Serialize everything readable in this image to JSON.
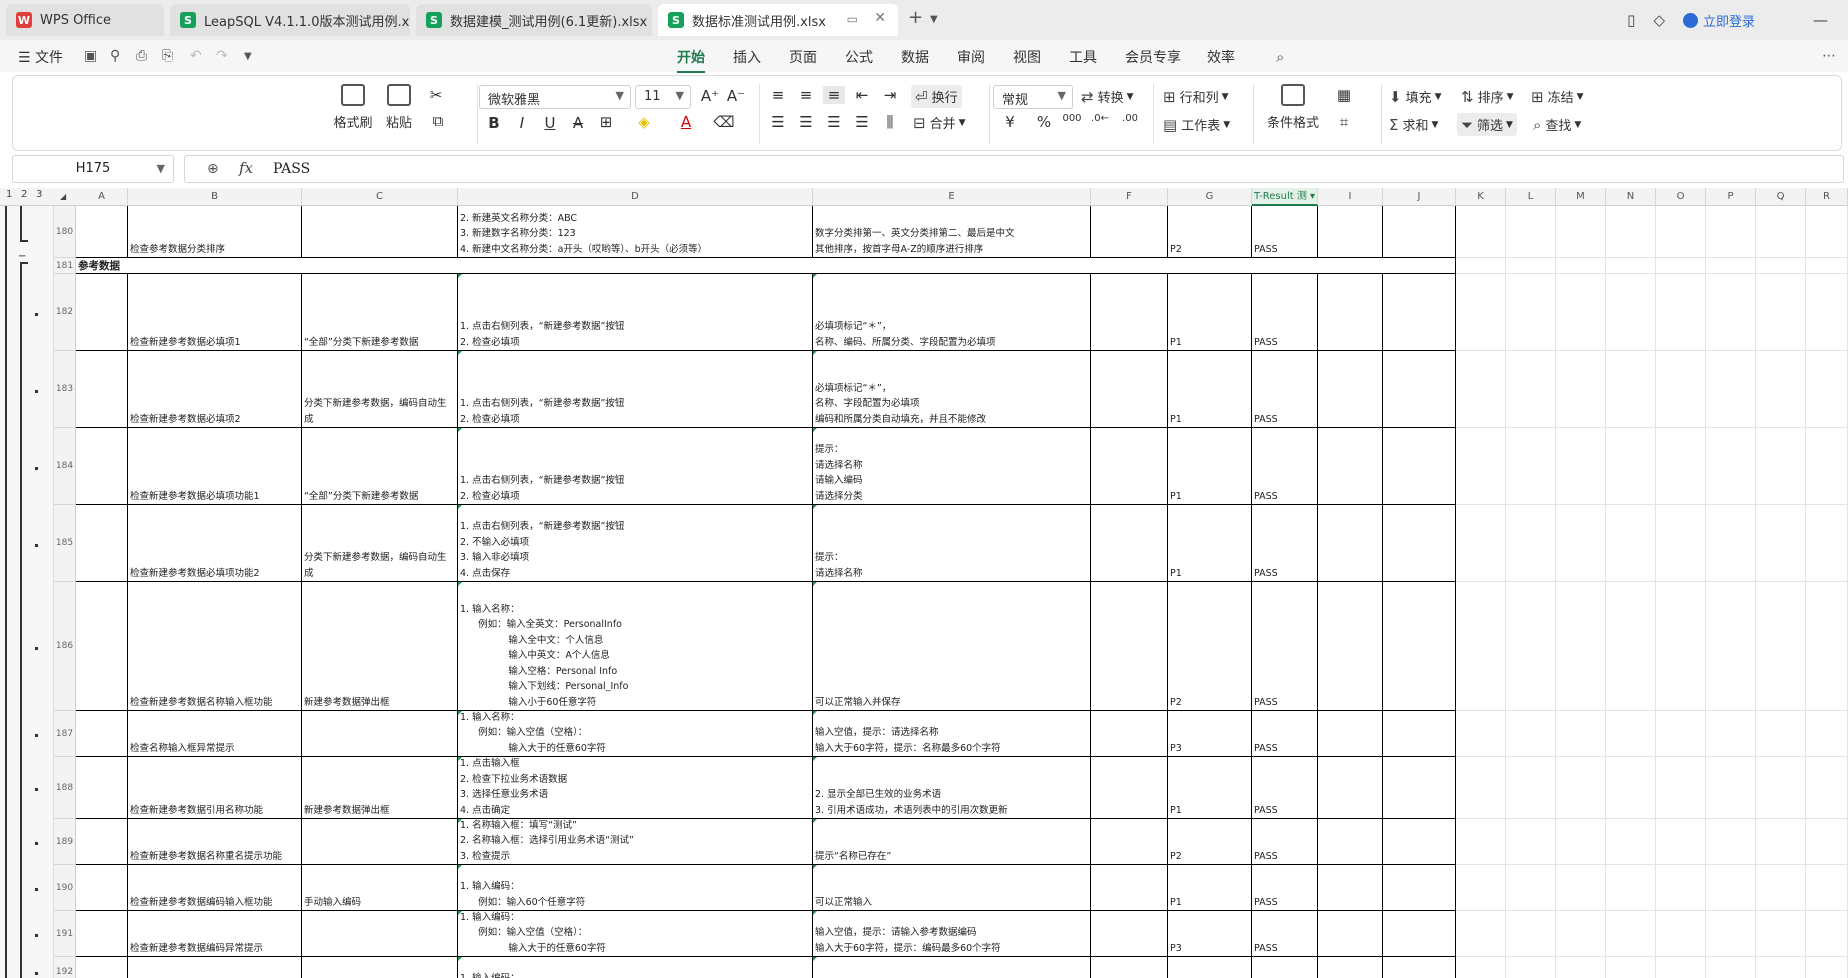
{
  "tabs": [
    {
      "label": "WPS Office",
      "icon": "W",
      "active": false
    },
    {
      "label": "LeapSQL V4.1.1.0版本测试用例.xlsx",
      "icon": "S",
      "active": false
    },
    {
      "label": "数据建模_测试用例(6.1更新).xlsx",
      "icon": "S",
      "active": false
    },
    {
      "label": "数据标准测试用例.xlsx",
      "icon": "S",
      "active": true
    }
  ],
  "titlebar": {
    "login": "立即登录"
  },
  "menu": {
    "file": "文件",
    "items": [
      "开始",
      "插入",
      "页面",
      "公式",
      "数据",
      "审阅",
      "视图",
      "工具",
      "会员专享",
      "效率"
    ],
    "active": "开始"
  },
  "ribbon": {
    "format_painter": "格式刷",
    "paste": "粘贴",
    "font_name": "微软雅黑",
    "font_size": "11",
    "wrap": "换行",
    "merge": "合并",
    "number_format": "常规",
    "convert": "转换",
    "row_col": "行和列",
    "worksheet": "工作表",
    "cond_format": "条件格式",
    "fill": "填充",
    "sort": "排序",
    "freeze": "冻结",
    "sum": "求和",
    "filter": "筛选",
    "find": "查找"
  },
  "formula_bar": {
    "name_box": "H175",
    "fx": "fx",
    "value": "PASS"
  },
  "grid": {
    "outline_levels": [
      "1",
      "2",
      "3"
    ],
    "columns": [
      "A",
      "B",
      "C",
      "D",
      "E",
      "F",
      "G",
      "T-Result 测",
      "I",
      "J",
      "K",
      "L",
      "M",
      "N",
      "O",
      "P",
      "Q",
      "R"
    ],
    "section_title": "参考数据",
    "rows": [
      {
        "num": "180",
        "b": "检查参考数据分类排序",
        "c": "",
        "d": "2. 新建英文名称分类：ABC\n3. 新建数字名称分类：123\n4. 新建中文名称分类：a开头（哎哟等）、b开头（必须等）",
        "e": "数字分类排第一、英文分类排第二、最后是中文\n其他排序，按首字母A-Z的顺序进行排序",
        "g": "P2",
        "h": "PASS"
      },
      {
        "num": "181",
        "section": true
      },
      {
        "num": "182",
        "b": "检查新建参考数据必填项1",
        "c": "“全部”分类下新建参考数据",
        "d": "1. 点击右侧列表，“新建参考数据”按钮\n2. 检查必填项",
        "e": "必填项标记“＊”，\n名称、编码、所属分类、字段配置为必填项",
        "g": "P1",
        "h": "PASS"
      },
      {
        "num": "183",
        "b": "检查新建参考数据必填项2",
        "c": "分类下新建参考数据，编码自动生\n成",
        "d": "1. 点击右侧列表，“新建参考数据”按钮\n2. 检查必填项",
        "e": "必填项标记“＊”，\n名称、字段配置为必填项\n编码和所属分类自动填充，并且不能修改",
        "g": "P1",
        "h": "PASS"
      },
      {
        "num": "184",
        "b": "检查新建参考数据必填项功能1",
        "c": "“全部”分类下新建参考数据",
        "d": "1. 点击右侧列表，“新建参考数据”按钮\n2. 检查必填项",
        "e": "提示：\n请选择名称\n请输入编码\n请选择分类",
        "g": "P1",
        "h": "PASS"
      },
      {
        "num": "185",
        "b": "检查新建参考数据必填项功能2",
        "c": "分类下新建参考数据，编码自动生\n成",
        "d": "1. 点击右侧列表，“新建参考数据”按钮\n2. 不输入必填项\n3. 输入非必填项\n4. 点击保存",
        "e": "提示：\n请选择名称",
        "g": "P1",
        "h": "PASS"
      },
      {
        "num": "186",
        "b": "检查新建参考数据名称输入框功能",
        "c": "新建参考数据弹出框",
        "d": "1. 输入名称：\n      例如：输入全英文：PersonalInfo\n                输入全中文：个人信息\n                输入中英文：A个人信息\n                输入空格：Personal Info\n                输入下划线：Personal_Info\n                输入小于60任意字符",
        "e": "可以正常输入并保存",
        "g": "P2",
        "h": "PASS"
      },
      {
        "num": "187",
        "b": "检查名称输入框异常提示",
        "c": "",
        "d": "1. 输入名称：\n      例如：输入空值（空格）：\n                输入大于的任意60字符",
        "e": "输入空值，提示：请选择名称\n输入大于60字符，提示：名称最多60个字符",
        "g": "P3",
        "h": "PASS"
      },
      {
        "num": "188",
        "b": "检查新建参考数据引用名称功能",
        "c": "新建参考数据弹出框",
        "d": "1. 点击输入框\n2. 检查下拉业务术语数据\n3. 选择任意业务术语\n4. 点击确定",
        "e": "2. 显示全部已生效的业务术语\n3. 引用术语成功，术语列表中的引用次数更新",
        "g": "P1",
        "h": "PASS"
      },
      {
        "num": "189",
        "b": "检查新建参考数据名称重名提示功能",
        "c": "",
        "d": "1. 名称输入框：填写“测试”\n2. 名称输入框：选择引用业务术语“测试”\n3. 检查提示",
        "e": "提示“名称已存在”",
        "g": "P2",
        "h": "PASS"
      },
      {
        "num": "190",
        "b": "检查新建参考数据编码输入框功能",
        "c": "手动输入编码",
        "d": "1. 输入编码：\n      例如：输入60个任意字符",
        "e": "可以正常输入",
        "g": "P1",
        "h": "PASS"
      },
      {
        "num": "191",
        "b": "检查新建参考数据编码异常提示",
        "c": "",
        "d": "1. 输入编码：\n      例如：输入空值（空格）：\n                输入大于的任意60字符",
        "e": "输入空值，提示：请输入参考数据编码\n输入大于60字符，提示：编码最多60个字符",
        "g": "P3",
        "h": "PASS"
      },
      {
        "num": "192",
        "b": "",
        "c": "",
        "d": "1. 输入编码：",
        "e": "",
        "g": "",
        "h": ""
      }
    ]
  }
}
